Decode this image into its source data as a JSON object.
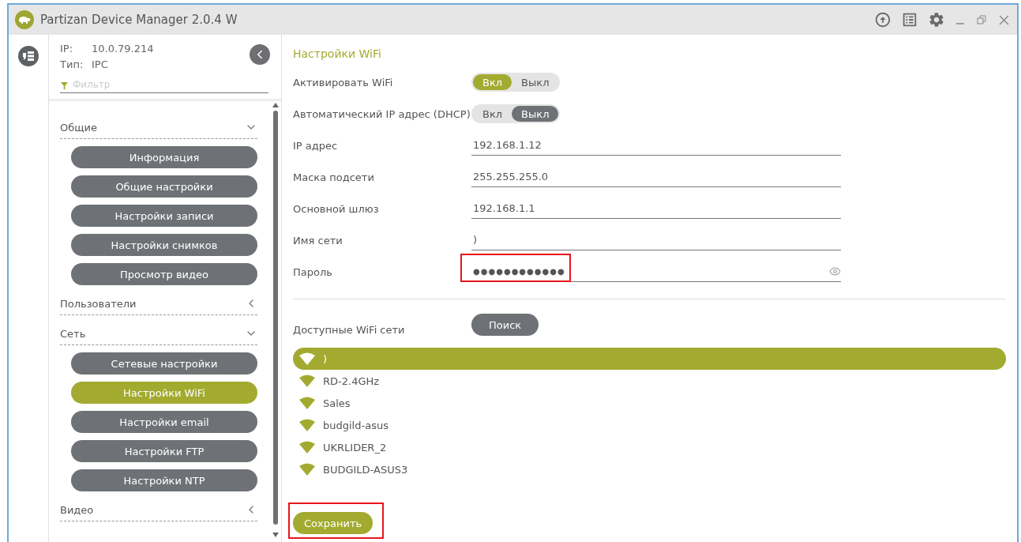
{
  "window": {
    "title": "Partizan Device Manager 2.0.4 W"
  },
  "device": {
    "ip_label": "IP:",
    "ip": "10.0.79.214",
    "type_label": "Тип:",
    "type": "IPC"
  },
  "filter": {
    "placeholder": "Фильтр"
  },
  "menu": [
    {
      "label": "Общие",
      "expanded": true,
      "children": [
        {
          "label": "Информация",
          "selected": false
        },
        {
          "label": "Общие настройки",
          "selected": false
        },
        {
          "label": "Настройки записи",
          "selected": false
        },
        {
          "label": "Настройки снимков",
          "selected": false
        },
        {
          "label": "Просмотр видео",
          "selected": false
        }
      ]
    },
    {
      "label": "Пользователи",
      "expanded": false
    },
    {
      "label": "Сеть",
      "expanded": true,
      "children": [
        {
          "label": "Сетевые настройки",
          "selected": false
        },
        {
          "label": "Настройки WiFi",
          "selected": true
        },
        {
          "label": "Настройки email",
          "selected": false
        },
        {
          "label": "Настройки FTP",
          "selected": false
        },
        {
          "label": "Настройки NTP",
          "selected": false
        }
      ]
    },
    {
      "label": "Видео",
      "expanded": false
    }
  ],
  "panel": {
    "title": "Настройки WiFi",
    "settings": [
      {
        "kind": "toggle",
        "label": "Активировать WiFi",
        "options": [
          {
            "label": "Вкл",
            "selected": true
          },
          {
            "label": "Выкл",
            "selected": false
          }
        ]
      },
      {
        "kind": "toggle",
        "label": "Автоматический IP адрес (DHCP)",
        "options": [
          {
            "label": "Вкл",
            "selected": false
          },
          {
            "label": "Выкл",
            "selected": true
          }
        ]
      },
      {
        "kind": "text",
        "label": "IP адрес",
        "value": "192.168.1.12"
      },
      {
        "kind": "text",
        "label": "Маска подсети",
        "value": "255.255.255.0"
      },
      {
        "kind": "text",
        "label": "Основной шлюз",
        "value": "192.168.1.1"
      },
      {
        "kind": "text",
        "label": "Имя сети",
        "value": ")"
      },
      {
        "kind": "password",
        "label": "Пароль",
        "value": "●●●●●●●●●●●●",
        "highlighted": true
      }
    ]
  },
  "networks": {
    "label": "Доступные WiFi сети",
    "search_button": "Поиск",
    "items": [
      {
        "name": ")",
        "selected": true
      },
      {
        "name": "RD-2.4GHz",
        "selected": false
      },
      {
        "name": "Sales",
        "selected": false
      },
      {
        "name": "budgild-asus",
        "selected": false
      },
      {
        "name": "UKRLIDER_2",
        "selected": false
      },
      {
        "name": "BUDGILD-ASUS3",
        "selected": false
      }
    ]
  },
  "save_button": {
    "label": "Сохранить",
    "highlighted": true
  }
}
